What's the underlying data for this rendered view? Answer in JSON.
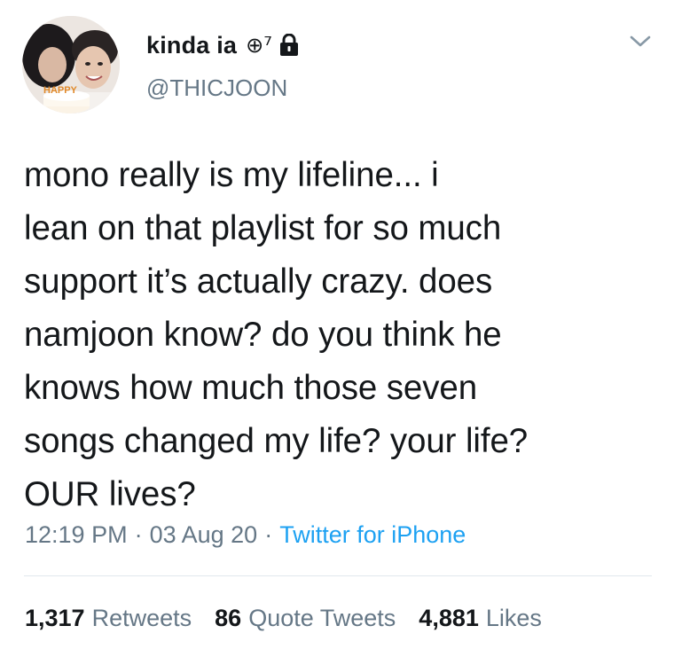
{
  "user": {
    "display_name": "kinda ia",
    "name_glyph": "⊕⁷",
    "handle": "@THICJOON",
    "avatar_caption": "HAPPY"
  },
  "tweet": {
    "text": "mono really is my lifeline... i\nlean on that playlist for so much\nsupport it’s actually crazy. does\nnamjoon know? do you think he\nknows how much those seven\nsongs changed my life? your life?\nOUR lives?",
    "time": "12:19 PM",
    "date": "03 Aug 20",
    "separator": "·",
    "source": "Twitter for iPhone"
  },
  "stats": {
    "retweets_count": "1,317",
    "retweets_label": "Retweets",
    "quotes_count": "86",
    "quotes_label": "Quote Tweets",
    "likes_count": "4,881",
    "likes_label": "Likes"
  },
  "icons": {
    "lock": "lock-icon",
    "caret": "chevron-down-icon"
  },
  "colors": {
    "text": "#14171a",
    "secondary": "#657786",
    "link": "#1da1f2",
    "divider": "#e1e8ed"
  }
}
